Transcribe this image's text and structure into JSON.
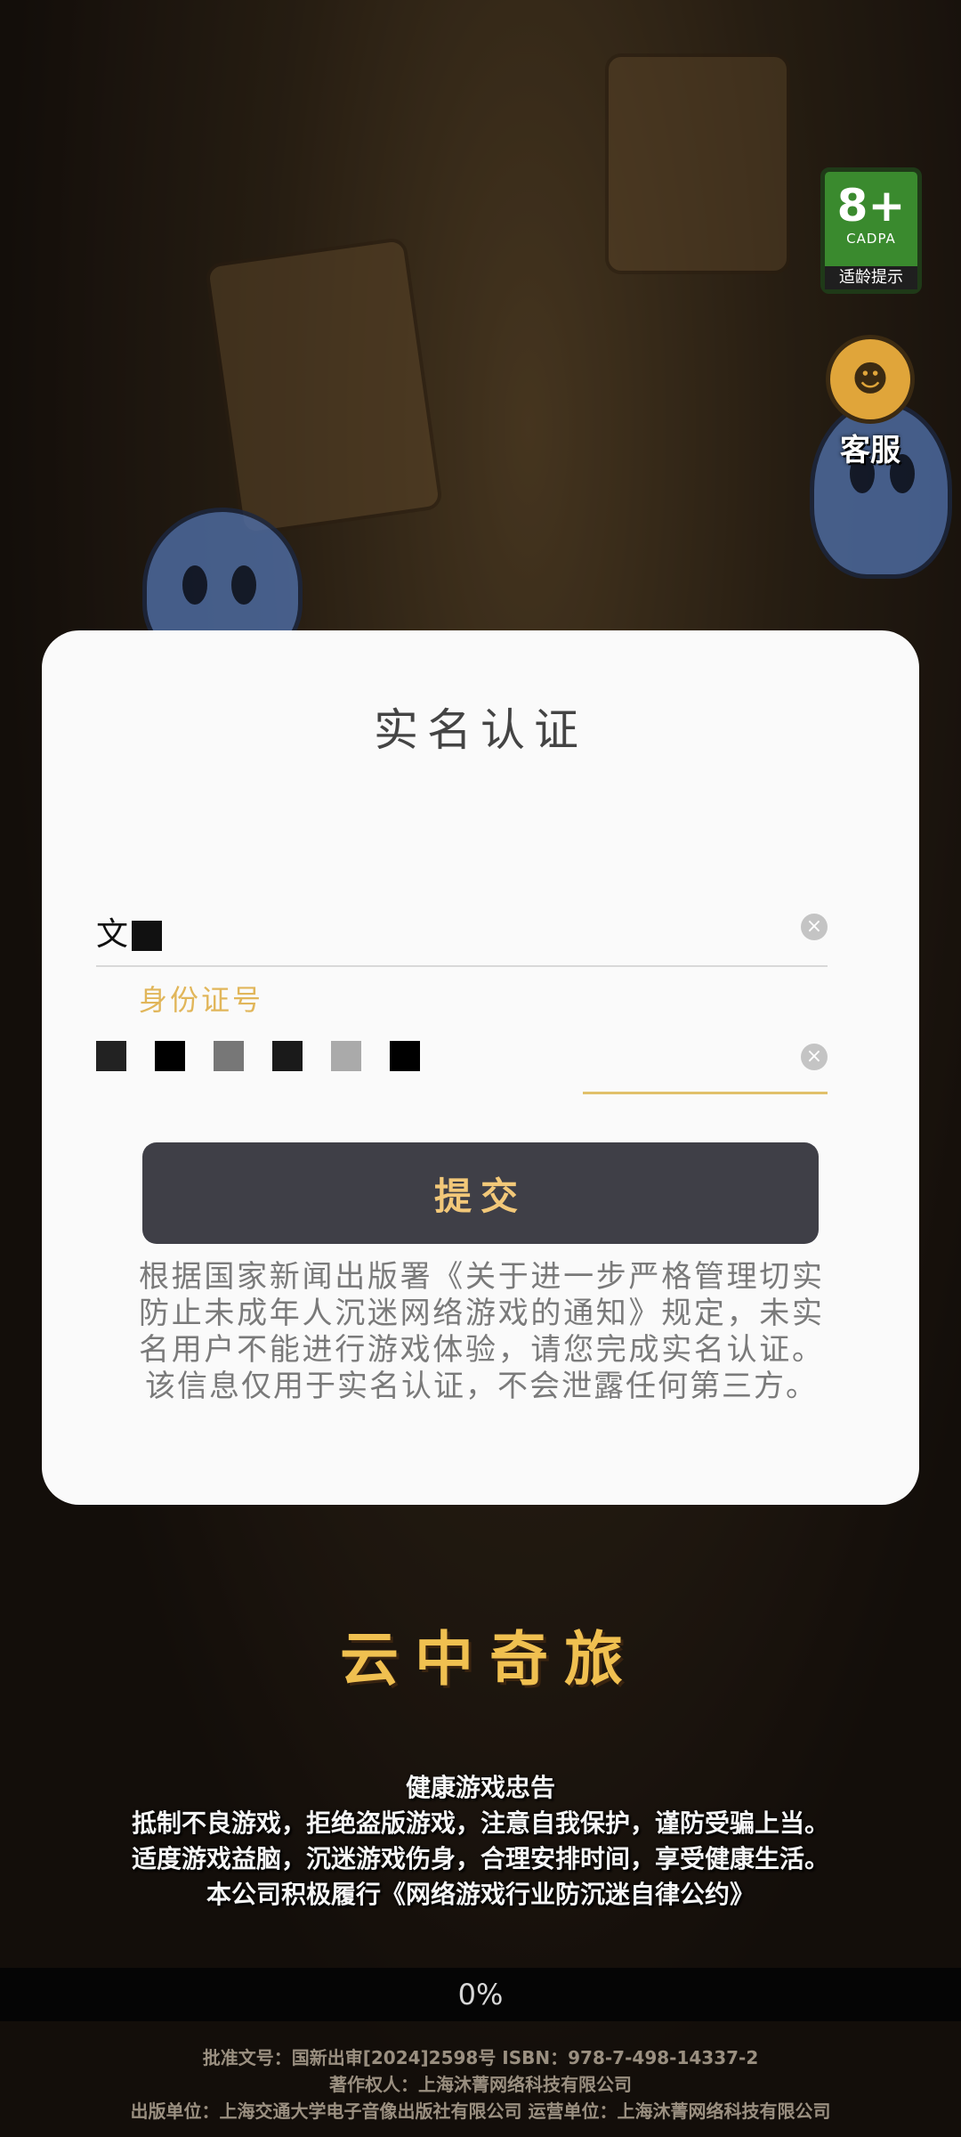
{
  "badges": {
    "age_rating": "8+",
    "age_org": "CADPA",
    "age_tip": "适龄提示",
    "customer_service": "客服"
  },
  "modal": {
    "title": "实名认证",
    "name_value": "文",
    "id_label": "身份证号",
    "submit_label": "提交",
    "notice": "根据国家新闻出版署《关于进一步严格管理切实防止未成年人沉迷网络游戏的通知》规定，未实名用户不能进行游戏体验，请您完成实名认证。该信息仅用于实名认证，不会泄露任何第三方。"
  },
  "game": {
    "logo_main": "",
    "logo_sub": "云中奇旅"
  },
  "health_notice": {
    "title": "健康游戏忠告",
    "line1": "抵制不良游戏，拒绝盗版游戏，注意自我保护，谨防受骗上当。",
    "line2": "适度游戏益脑，沉迷游戏伤身，合理安排时间，享受健康生活。",
    "line3": "本公司积极履行《网络游戏行业防沉迷自律公约》"
  },
  "progress": {
    "value": 0,
    "label": "0%"
  },
  "footer": {
    "line1": "批准文号：国新出审[2024]2598号 ISBN：978-7-498-14337-2",
    "line2": "著作权人：上海沐菁网络科技有限公司",
    "line3": "出版单位：上海交通大学电子音像出版社有限公司 运营单位：上海沐菁网络科技有限公司"
  },
  "colors": {
    "accent": "#e1b65a",
    "submit_bg": "#3f3f47",
    "submit_text": "#f2c879",
    "age_badge": "#3a8a2e"
  }
}
